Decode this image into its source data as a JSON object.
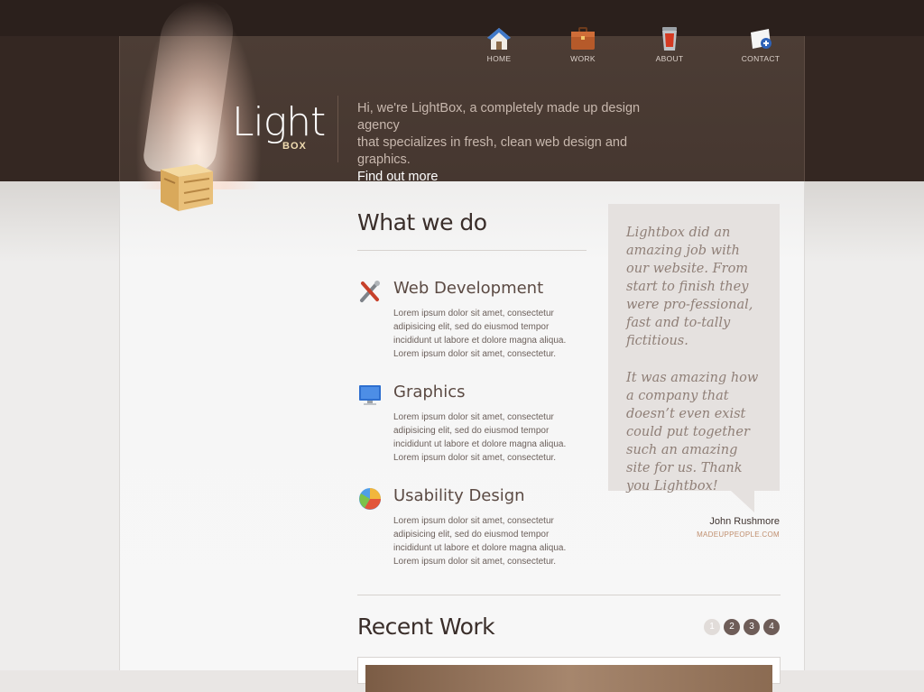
{
  "brand": {
    "logo_main": "Light",
    "logo_sub": "BOX"
  },
  "nav": [
    {
      "label": "HOME",
      "icon": "home-icon"
    },
    {
      "label": "WORK",
      "icon": "briefcase-icon"
    },
    {
      "label": "ABOUT",
      "icon": "trash-can-icon"
    },
    {
      "label": "CONTACT",
      "icon": "contact-card-icon"
    }
  ],
  "intro": {
    "line1": "Hi, we're LightBox, a completely made up design agency",
    "line2": "that specializes in fresh, clean web design and graphics.",
    "link": "Find out more"
  },
  "what_we_do": {
    "title": "What we do",
    "services": [
      {
        "title": "Web Development",
        "icon": "tools-icon",
        "text": "Lorem ipsum dolor sit amet, consectetur adipisicing elit, sed do eiusmod tempor incididunt ut labore et dolore magna aliqua. Lorem ipsum dolor sit amet, consectetur."
      },
      {
        "title": "Graphics",
        "icon": "monitor-icon",
        "text": "Lorem ipsum dolor sit amet, consectetur adipisicing elit, sed do eiusmod tempor incididunt ut labore et dolore magna aliqua. Lorem ipsum dolor sit amet, consectetur."
      },
      {
        "title": "Usability Design",
        "icon": "pie-chart-icon",
        "text": "Lorem ipsum dolor sit amet, consectetur adipisicing elit, sed do eiusmod tempor incididunt ut labore et dolore magna aliqua. Lorem ipsum dolor sit amet, consectetur."
      }
    ]
  },
  "testimonial": {
    "p1": "Lightbox did an amazing job with our website. From start to finish they were pro-fessional, fast and to-tally fictitious.",
    "p2": "It was amazing how a company that doesn’t even exist could put together such an amazing site for us. Thank you Lightbox!",
    "name": "John Rushmore",
    "site": "MADEUPPEOPLE.COM"
  },
  "recent_work": {
    "title": "Recent Work",
    "pages": [
      "1",
      "2",
      "3",
      "4"
    ],
    "active_page": "1"
  },
  "colors": {
    "header": "#4a3a33",
    "accent": "#c08f6f",
    "pager": "#6e5d58"
  }
}
